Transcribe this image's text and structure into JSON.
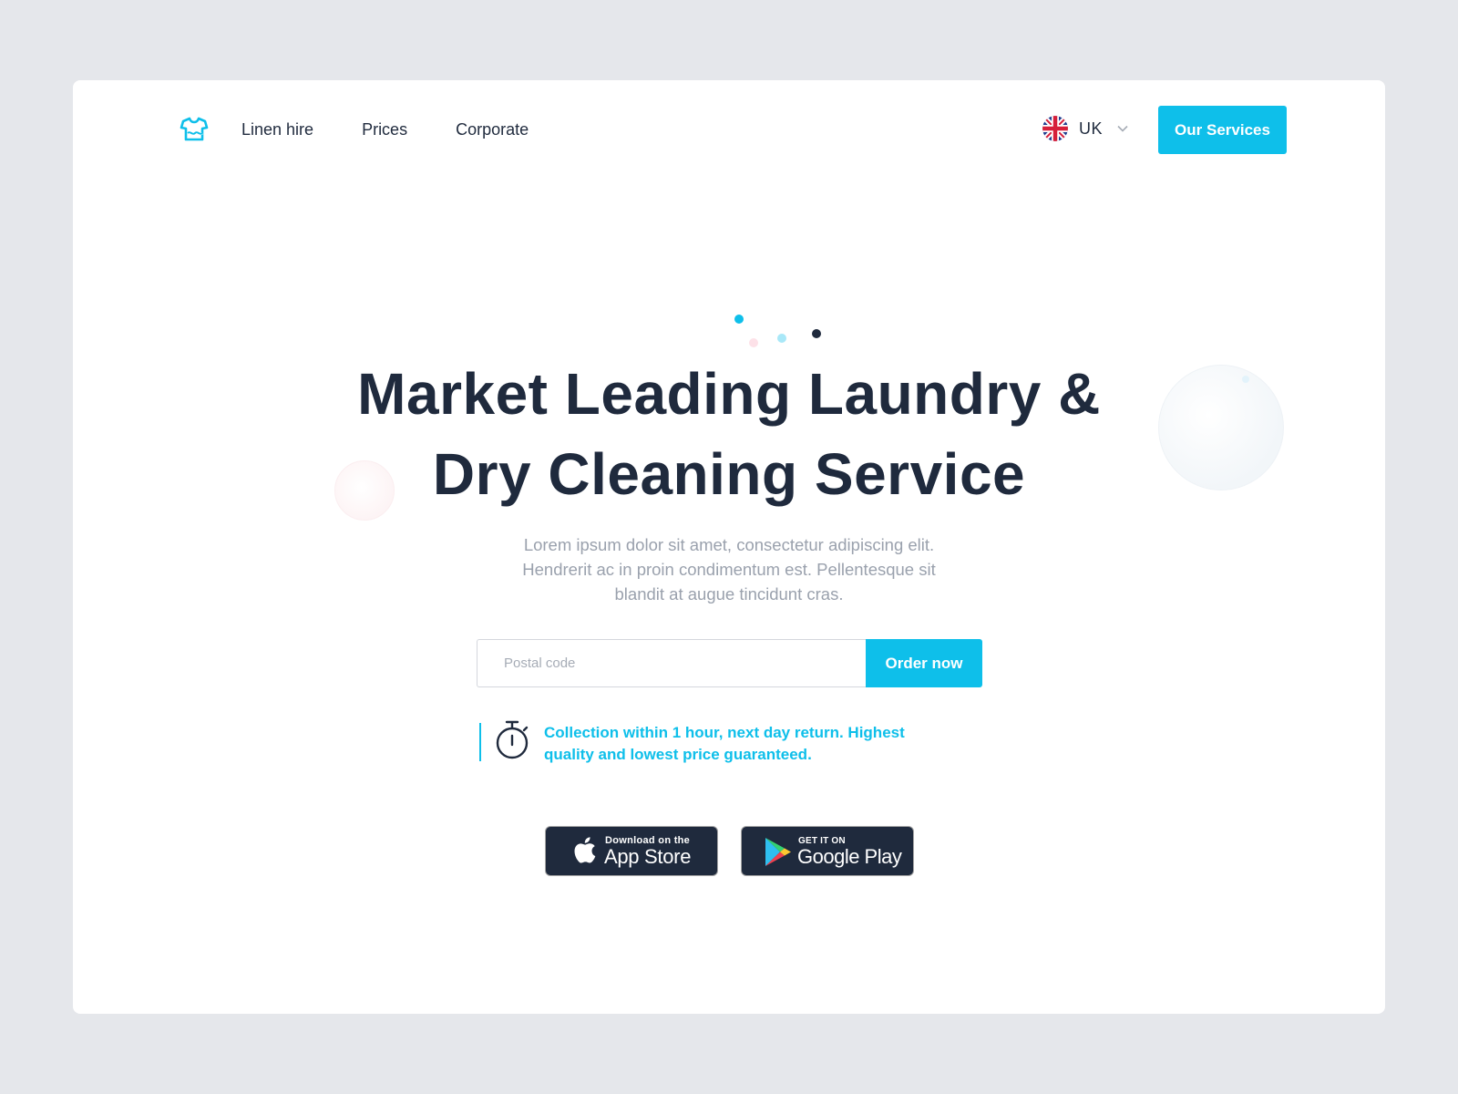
{
  "header": {
    "logo_icon": "tshirt-icon",
    "nav": [
      "Linen hire",
      "Prices",
      "Corporate"
    ],
    "language": {
      "label": "UK",
      "flag_icon": "uk-flag-icon"
    },
    "cta_label": "Our Services"
  },
  "hero": {
    "title_line1": "Market Leading Laundry &",
    "title_line2": "Dry Cleaning Service",
    "subtitle_line1": "Lorem ipsum dolor sit amet, consectetur adipiscing elit.",
    "subtitle_line2": "Hendrerit ac in proin condimentum est. Pellentesque sit",
    "subtitle_line3": "blandit at augue tincidunt cras.",
    "postal_placeholder": "Postal code",
    "order_label": "Order now",
    "note_line1": "Collection within 1 hour, next day return. Highest",
    "note_line2": "quality and lowest price guaranteed.",
    "note_icon": "stopwatch-icon"
  },
  "stores": {
    "apple_small": "Download on the",
    "apple_big": "App Store",
    "google_small": "GET IT ON",
    "google_big": "Google Play"
  },
  "colors": {
    "accent": "#0ebfea",
    "dark": "#1f2a3d",
    "muted": "#9aa1ad",
    "background": "#e5e7eb"
  }
}
